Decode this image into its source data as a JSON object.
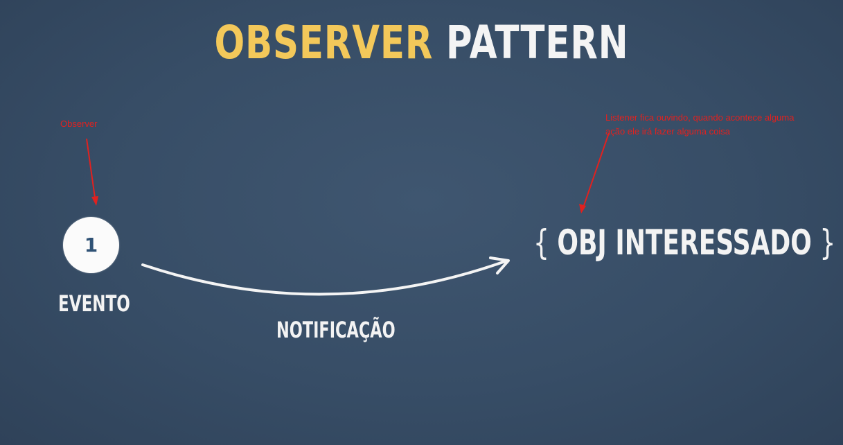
{
  "title": {
    "part1": "OBSERVER",
    "part2": "PATTERN"
  },
  "diagram": {
    "node_number": "1",
    "event_label": "EVENTO",
    "notification_label": "NOTIFICAÇÃO",
    "target_open_brace": "{",
    "target_label": "OBJ INTERESSADO",
    "target_close_brace": "}"
  },
  "annotations": {
    "observer_note": "Observer",
    "listener_note": "Listener fica ouvindo, quando acontece alguma ação ele irá fazer alguma coisa"
  },
  "colors": {
    "background": "#374d66",
    "title_accent": "#f3c85a",
    "chalk": "#f4f4f4",
    "annotation": "#e1211f",
    "node_number": "#2f5275"
  }
}
